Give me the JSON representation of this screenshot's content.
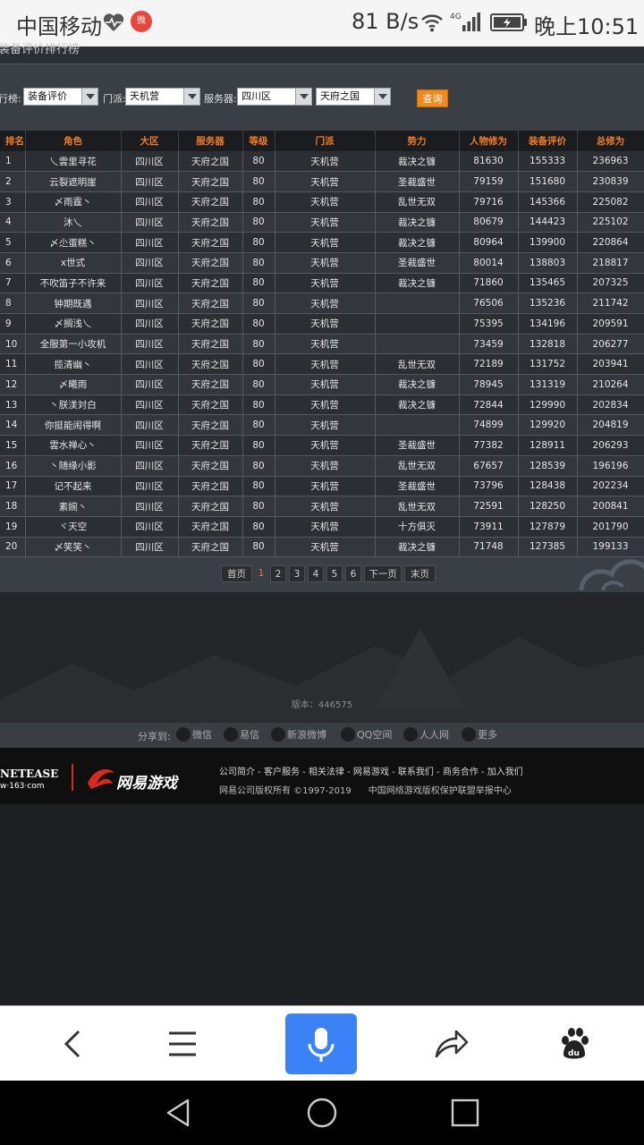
{
  "status_bar": {
    "carrier": "中国移动",
    "weibo_badge": "微",
    "speed": "81 B/s",
    "network": "4G",
    "time": "晚上10:51"
  },
  "page": {
    "section_title": "装备评价排行榜",
    "filters": {
      "rank_label": "行榜:",
      "rank_value": "装备评价",
      "school_label": "门派:",
      "school_value": "天机营",
      "server_label": "服务器:",
      "server_region": "四川区",
      "server_name": "天府之国",
      "query_label": "查询"
    },
    "table": {
      "headers": [
        "排名",
        "角色",
        "大区",
        "服务器",
        "等级",
        "门派",
        "势力",
        "人物修为",
        "装备评价",
        "总修为"
      ],
      "rows": [
        [
          "1",
          "乀雲里寻花",
          "四川区",
          "天府之国",
          "80",
          "天机营",
          "裁决之镰",
          "81630",
          "155333",
          "236963"
        ],
        [
          "2",
          "云裂遮明崖",
          "四川区",
          "天府之国",
          "80",
          "天机营",
          "圣裁盛世",
          "79159",
          "151680",
          "230839"
        ],
        [
          "3",
          "〆雨霆丶",
          "四川区",
          "天府之国",
          "80",
          "天机营",
          "乱世无双",
          "79716",
          "145366",
          "225082"
        ],
        [
          "4",
          "沐乀",
          "四川区",
          "天府之国",
          "80",
          "天机营",
          "裁决之镰",
          "80679",
          "144423",
          "225102"
        ],
        [
          "5",
          "〆尐蛋糕丶",
          "四川区",
          "天府之国",
          "80",
          "天机营",
          "裁决之镰",
          "80964",
          "139900",
          "220864"
        ],
        [
          "6",
          "ⅹ世式",
          "四川区",
          "天府之国",
          "80",
          "天机营",
          "圣裁盛世",
          "80014",
          "138803",
          "218817"
        ],
        [
          "7",
          "不吹笛子不许来",
          "四川区",
          "天府之国",
          "80",
          "天机营",
          "裁决之镰",
          "71860",
          "135465",
          "207325"
        ],
        [
          "8",
          "钟期既遇",
          "四川区",
          "天府之国",
          "80",
          "天机营",
          "",
          "76506",
          "135236",
          "211742"
        ],
        [
          "9",
          "〆搁浅乀",
          "四川区",
          "天府之国",
          "80",
          "天机营",
          "",
          "75395",
          "134196",
          "209591"
        ],
        [
          "10",
          "全服第一小攻机",
          "四川区",
          "天府之国",
          "80",
          "天机营",
          "",
          "73459",
          "132818",
          "206277"
        ],
        [
          "11",
          "揽清幽丶",
          "四川区",
          "天府之国",
          "80",
          "天机营",
          "乱世无双",
          "72189",
          "131752",
          "203941"
        ],
        [
          "12",
          "〆曦雨",
          "四川区",
          "天府之国",
          "80",
          "天机营",
          "裁决之镰",
          "78945",
          "131319",
          "210264"
        ],
        [
          "13",
          "丶朕渼対白",
          "四川区",
          "天府之国",
          "80",
          "天机营",
          "裁决之镰",
          "72844",
          "129990",
          "202834"
        ],
        [
          "14",
          "你挺能闹得啊",
          "四川区",
          "天府之国",
          "80",
          "天机营",
          "",
          "74899",
          "129920",
          "204819"
        ],
        [
          "15",
          "雲水禅心丶",
          "四川区",
          "天府之国",
          "80",
          "天机营",
          "圣裁盛世",
          "77382",
          "128911",
          "206293"
        ],
        [
          "16",
          "丶随缘小影",
          "四川区",
          "天府之国",
          "80",
          "天机营",
          "乱世无双",
          "67657",
          "128539",
          "196196"
        ],
        [
          "17",
          "记不起来",
          "四川区",
          "天府之国",
          "80",
          "天机营",
          "圣裁盛世",
          "73796",
          "128438",
          "202234"
        ],
        [
          "18",
          "素婉丶",
          "四川区",
          "天府之国",
          "80",
          "天机营",
          "乱世无双",
          "72591",
          "128250",
          "200841"
        ],
        [
          "19",
          "ヾ天空",
          "四川区",
          "天府之国",
          "80",
          "天机营",
          "十方俱灭",
          "73911",
          "127879",
          "201790"
        ],
        [
          "20",
          "〆笑笑丶",
          "四川区",
          "天府之国",
          "80",
          "天机营",
          "裁决之镰",
          "71748",
          "127385",
          "199133"
        ]
      ]
    },
    "pager": {
      "first": "首页",
      "pages": [
        "1",
        "2",
        "3",
        "4",
        "5",
        "6"
      ],
      "current": "1",
      "next": "下一页",
      "last": "末页"
    },
    "version": "版本：446575",
    "share": {
      "label": "分享到:",
      "items": [
        "微信",
        "易信",
        "新浪微博",
        "QQ空间",
        "人人网",
        "更多"
      ]
    },
    "footer": {
      "netease": "NETEASE",
      "netease_sub": "w·163·com",
      "brand": "网易游戏",
      "links": "公司简介 - 客户服务 - 相关法律 - 网易游戏 - 联系我们 - 商务合作 - 加入我们",
      "copyright": "网易公司版权所有 ©1997-2019",
      "alliance": "中国网络游戏版权保护联盟举报中心"
    }
  },
  "colors": {
    "accent_orange": "#f08a1c",
    "header_orange": "#ef7d23",
    "mic_blue": "#3b82f6"
  }
}
